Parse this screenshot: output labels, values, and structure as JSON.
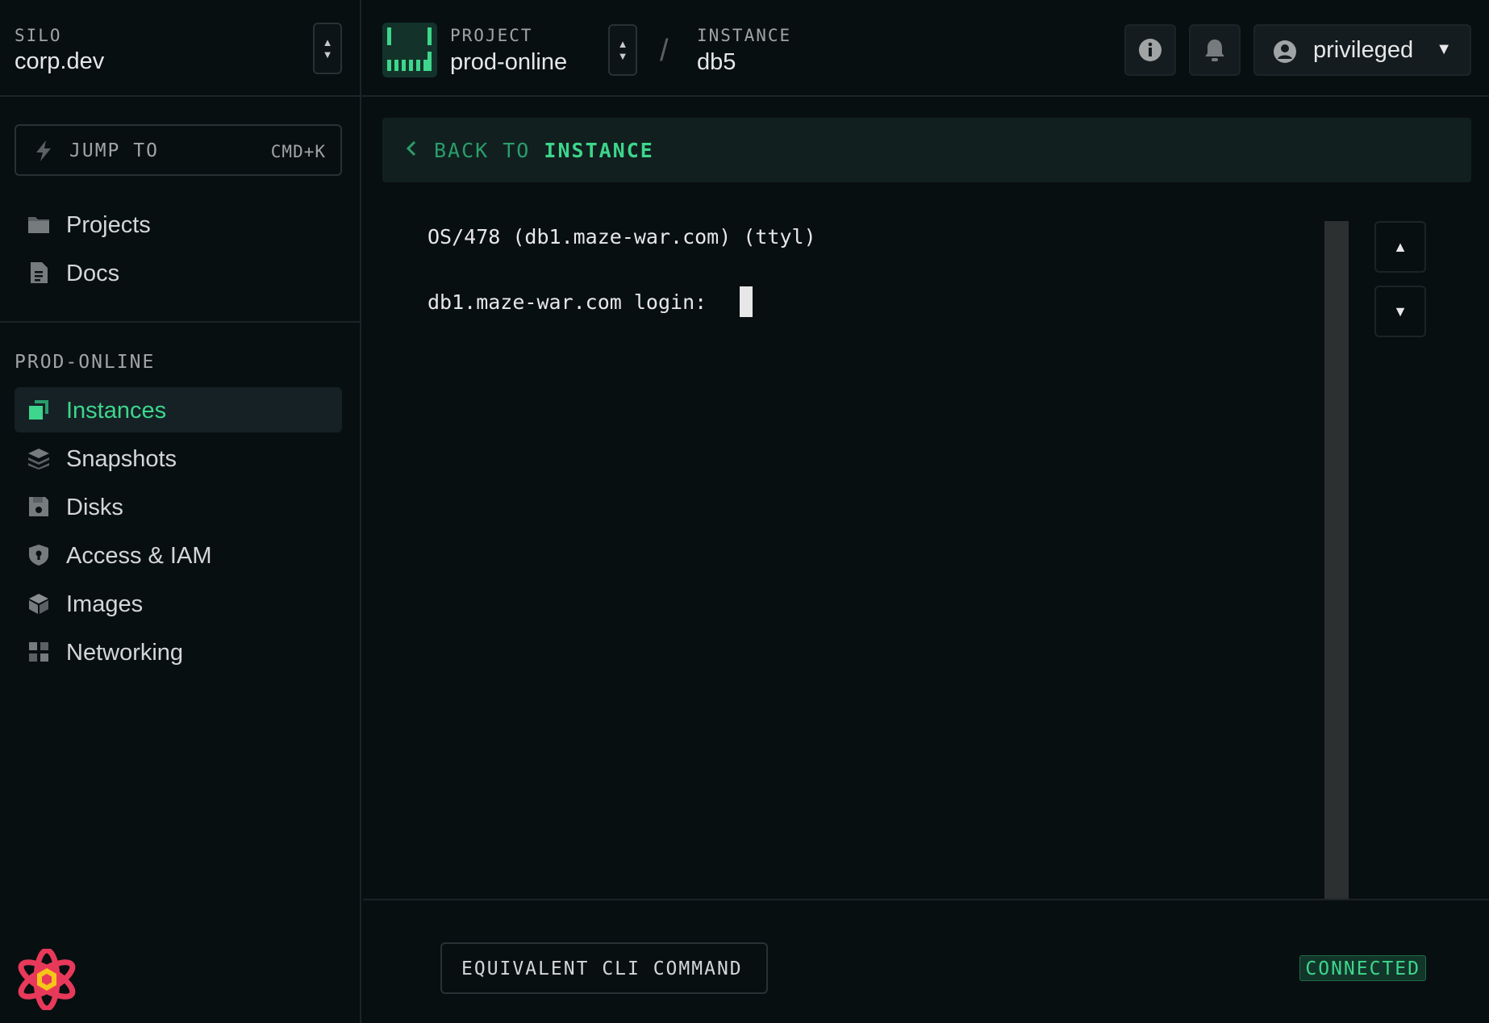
{
  "sidebar": {
    "silo_label": "SILO",
    "silo_value": "corp.dev",
    "jump_to": {
      "label": "JUMP TO",
      "shortcut": "CMD+K"
    },
    "general_items": [
      {
        "label": "Projects",
        "icon": "folder-icon"
      },
      {
        "label": "Docs",
        "icon": "document-icon"
      }
    ],
    "section_label": "PROD-ONLINE",
    "project_items": [
      {
        "label": "Instances",
        "icon": "instances-icon",
        "active": true
      },
      {
        "label": "Snapshots",
        "icon": "snapshots-icon"
      },
      {
        "label": "Disks",
        "icon": "disk-icon"
      },
      {
        "label": "Access & IAM",
        "icon": "shield-icon"
      },
      {
        "label": "Images",
        "icon": "images-icon"
      },
      {
        "label": "Networking",
        "icon": "networking-icon"
      }
    ]
  },
  "header": {
    "project_label": "PROJECT",
    "project_value": "prod-online",
    "separator": "/",
    "instance_label": "INSTANCE",
    "instance_value": "db5",
    "user": "privileged"
  },
  "back_link": {
    "prefix": "BACK TO",
    "target": "INSTANCE"
  },
  "terminal": {
    "lines": [
      "OS/478 (db1.maze-war.com) (ttyl)",
      "db1.maze-war.com login: "
    ]
  },
  "footer": {
    "cli_button": "EQUIVALENT CLI COMMAND",
    "status": "CONNECTED"
  },
  "colors": {
    "accent": "#3dd68c",
    "background": "#080f11",
    "border": "#1d2427"
  }
}
